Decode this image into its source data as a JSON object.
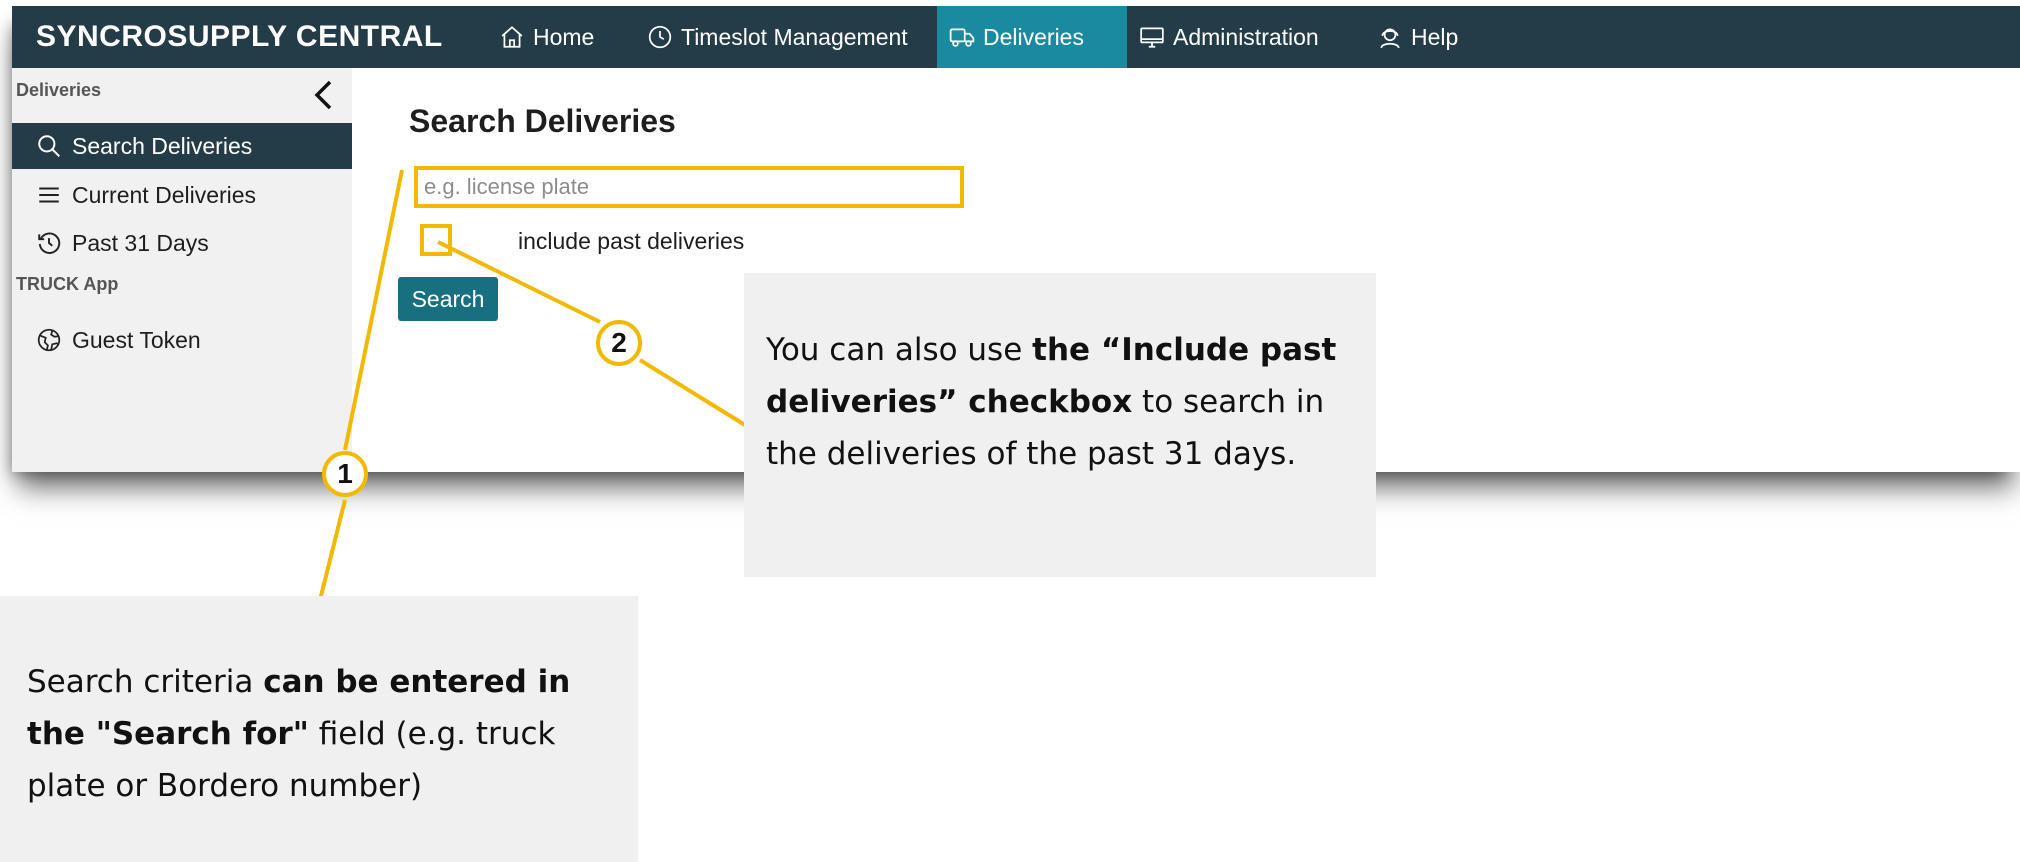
{
  "topnav": {
    "brand": "SYNCROSUPPLY CENTRAL",
    "items": [
      {
        "label": "Home",
        "icon": "home-icon"
      },
      {
        "label": "Timeslot Management",
        "icon": "clock-icon"
      },
      {
        "label": "Deliveries",
        "icon": "truck-icon",
        "active": true
      },
      {
        "label": "Administration",
        "icon": "monitor-icon"
      },
      {
        "label": "Help",
        "icon": "support-agent-icon"
      }
    ]
  },
  "sidebar": {
    "section_deliveries": "Deliveries",
    "items": [
      {
        "label": "Search Deliveries",
        "icon": "search-icon",
        "active": true
      },
      {
        "label": "Current Deliveries",
        "icon": "menu-icon"
      },
      {
        "label": "Past 31 Days",
        "icon": "history-icon"
      }
    ],
    "section_truck_app": "TRUCK App",
    "truck_items": [
      {
        "label": "Guest Token",
        "icon": "globe-icon"
      }
    ]
  },
  "main": {
    "title": "Search Deliveries",
    "search_placeholder": "e.g. license plate",
    "search_value": "",
    "include_past_label": "include past deliveries",
    "include_past_checked": false,
    "search_button": "Search"
  },
  "annotations": {
    "badge_1": "1",
    "badge_2": "2",
    "callout_1": {
      "t1": "Search criteria ",
      "b1": "can be entered in the \"Search for\"",
      "t2": " field (e.g. truck plate or Bordero number)"
    },
    "callout_2": {
      "t1": "You can also use ",
      "b1": "the “Include past deliveries” checkbox",
      "t2": " to search in the deliveries of the past 31 days."
    }
  },
  "colors": {
    "nav_bg": "#243c47",
    "nav_active": "#1a8aa0",
    "button_bg": "#176f80",
    "highlight": "#f2b900",
    "sidebar_bg": "#f1f1f1",
    "callout_bg": "#f0f0f0"
  }
}
